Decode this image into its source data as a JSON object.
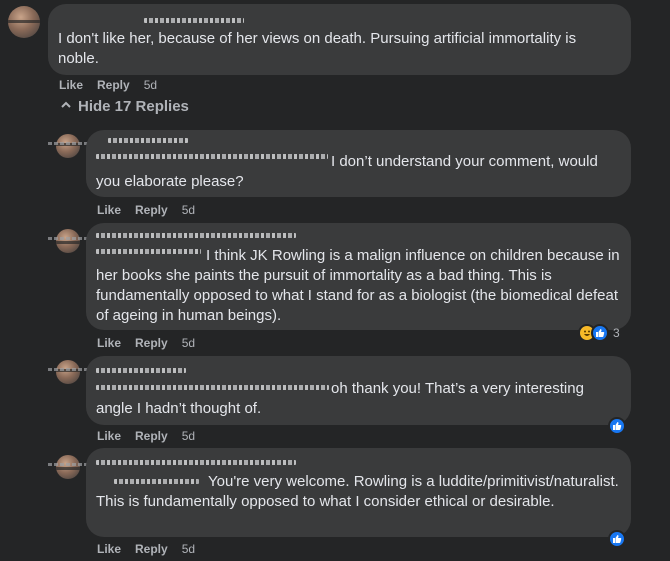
{
  "comments": [
    {
      "text": "I don't like her, because of her views on death. Pursuing artificial immortality is noble.",
      "like": "Like",
      "reply": "Reply",
      "time": "5d"
    }
  ],
  "hide_replies": "Hide 17 Replies",
  "replies": [
    {
      "text": "I don’t understand your comment, would you elaborate please?",
      "like": "Like",
      "reply": "Reply",
      "time": "5d"
    },
    {
      "text": "I think JK Rowling is a malign influence on children because in her books she paints the pursuit of immortality as a bad thing. This is fundamentally opposed to what I stand for as a biologist (the biomedical defeat of ageing in human beings).",
      "like": "Like",
      "reply": "Reply",
      "time": "5d",
      "reaction_count": "3",
      "reaction_icons": [
        "haha-icon",
        "like-icon"
      ]
    },
    {
      "text": "oh thank you! That’s a very interesting angle I hadn’t thought of.",
      "like": "Like",
      "reply": "Reply",
      "time": "5d",
      "reaction_icons": [
        "like-icon"
      ]
    },
    {
      "text": "You're very welcome. Rowling is a luddite/primitivist/naturalist. This is fundamentally opposed to what I consider ethical or desirable.",
      "like": "Like",
      "reply": "Reply",
      "time": "5d",
      "reaction_icons": [
        "like-icon"
      ]
    }
  ],
  "colors": {
    "background": "#242526",
    "bubble": "#3a3b3c",
    "text": "#e4e6eb",
    "meta": "#b0b3b8",
    "like_blue": "#1877f2",
    "haha_yellow": "#f7b928"
  }
}
